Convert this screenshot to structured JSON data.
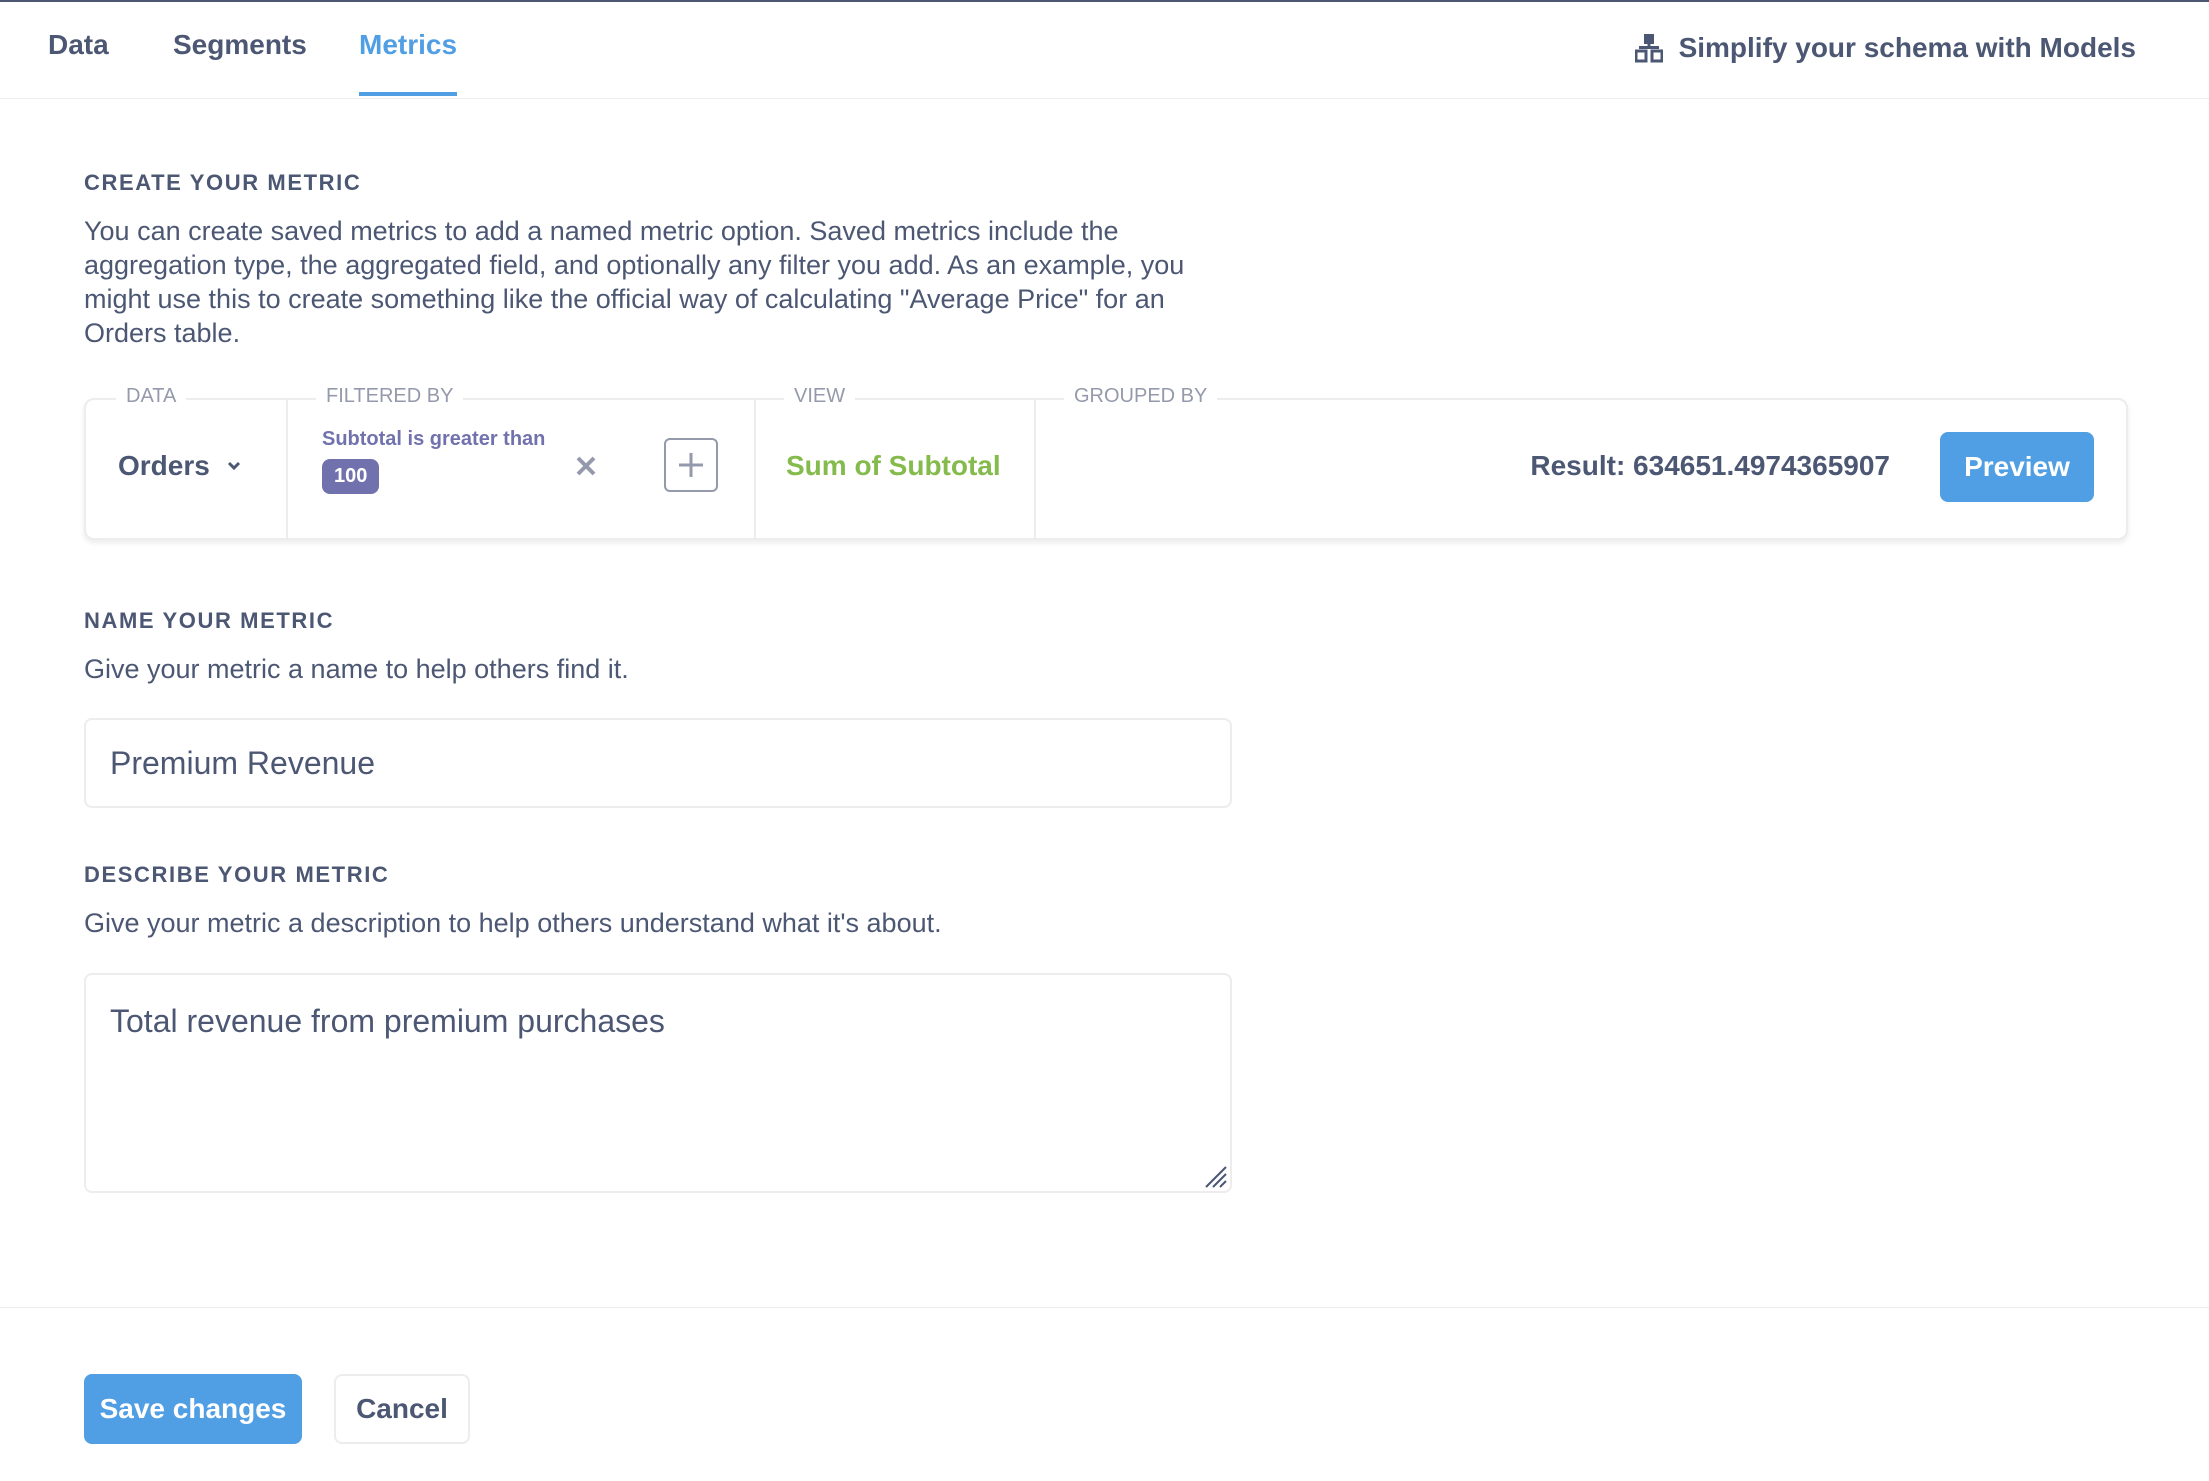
{
  "tabs": [
    {
      "label": "Data",
      "active": false
    },
    {
      "label": "Segments",
      "active": false
    },
    {
      "label": "Metrics",
      "active": true
    }
  ],
  "models_link": {
    "label": "Simplify your schema with Models",
    "icon": "model-icon"
  },
  "create_section": {
    "title": "CREATE YOUR METRIC",
    "description_lines": [
      "You can create saved metrics to add a named metric option. Saved metrics include the",
      "aggregation type, the aggregated field, and optionally any filter you add. As an example, you",
      "might use this to create something like the official way of calculating \"Average Price\" for an",
      "Orders table."
    ]
  },
  "builder": {
    "labels": {
      "data": "DATA",
      "filtered_by": "FILTERED BY",
      "view": "VIEW",
      "grouped_by": "GROUPED BY"
    },
    "data_source": "Orders",
    "filter": {
      "label": "Subtotal is greater than",
      "value": "100"
    },
    "view": "Sum of Subtotal",
    "result": "Result: 634651.4974365907",
    "preview_label": "Preview"
  },
  "name_section": {
    "title": "NAME YOUR METRIC",
    "description": "Give your metric a name to help others find it.",
    "value": "Premium Revenue"
  },
  "describe_section": {
    "title": "DESCRIBE YOUR METRIC",
    "description": "Give your metric a description to help others understand what it's about.",
    "value": "Total revenue from premium purchases"
  },
  "footer": {
    "save_label": "Save changes",
    "cancel_label": "Cancel"
  },
  "colors": {
    "brand": "#509ee3",
    "text": "#4c5773",
    "filter": "#7172ad",
    "view": "#84bb4c",
    "border": "#eeecec",
    "muted": "#949aab"
  }
}
